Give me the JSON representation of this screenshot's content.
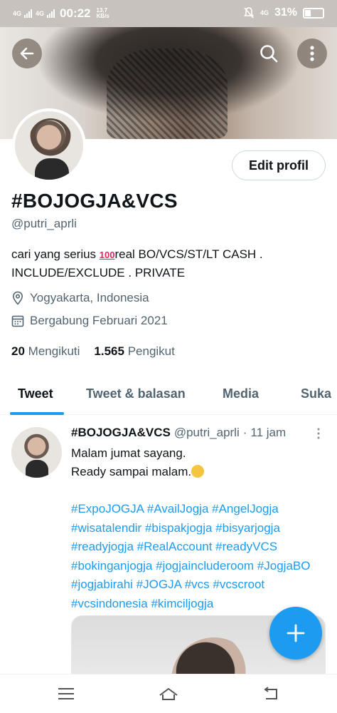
{
  "status_bar": {
    "signal1": "4G",
    "signal2": "4G",
    "time": "00:22",
    "speed_value": "13,7",
    "speed_unit": "KB/s",
    "right_net": "4G",
    "battery": "31%",
    "battery_level": 0.31
  },
  "header": {
    "back_icon": "arrow-left-icon",
    "search_icon": "search-icon",
    "more_icon": "more-vertical-icon"
  },
  "profile": {
    "edit_label": "Edit profil",
    "display_name": "#BOJOGJA&VCS",
    "handle": "@putri_aprli",
    "bio_before": "cari yang serius ",
    "bio_emoji": "100",
    "bio_after": "real BO/VCS/ST/LT CASH . INCLUDE/EXCLUDE . PRIVATE",
    "location": "Yogyakarta, Indonesia",
    "joined": "Bergabung Februari 2021",
    "following_count": "20",
    "following_label": "Mengikuti",
    "followers_count": "1.565",
    "followers_label": "Pengikut"
  },
  "tabs": [
    {
      "label": "Tweet",
      "active": true
    },
    {
      "label": "Tweet & balasan",
      "active": false
    },
    {
      "label": "Media",
      "active": false
    },
    {
      "label": "Suka",
      "active": false
    }
  ],
  "tweet": {
    "name": "#BOJOGJA&VCS",
    "handle": "@putri_aprli",
    "separator": "·",
    "time": "11 jam",
    "line1": "Malam jumat sayang.",
    "line2": "Ready sampai malam.",
    "hashtags": "#ExpoJOGJA #AvailJogja #AngelJogja #wisatalendir #bispakjogja #bisyarjogja #readyjogja #RealAccount #readyVCS #bokinganjogja #jogjaincluderoom #JogjaBO #jogjabirahi #JOGJA #vcs #vcscroot #vcsindonesia #kimciljogja"
  },
  "colors": {
    "accent": "#1d9bf0",
    "text": "#0f1419",
    "muted": "#536471"
  }
}
